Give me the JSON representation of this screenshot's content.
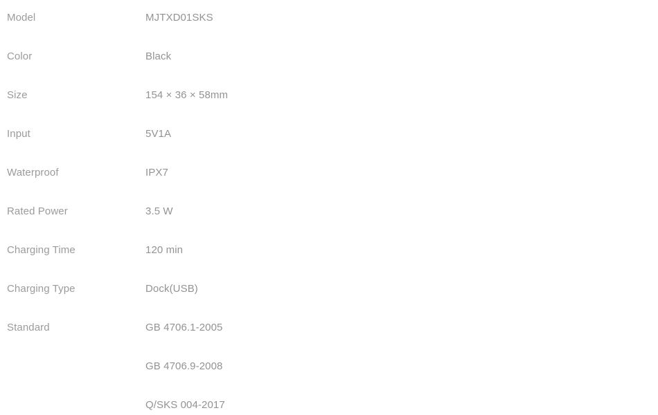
{
  "spec_table": {
    "rows": [
      {
        "label": "Model",
        "value": "MJTXD01SKS"
      },
      {
        "label": "Color",
        "value": "Black"
      },
      {
        "label": "Size",
        "value": "154 × 36 × 58mm"
      },
      {
        "label": "Input",
        "value": "5V1A"
      },
      {
        "label": "Waterproof",
        "value": "IPX7"
      },
      {
        "label": "Rated Power",
        "value": "3.5 W"
      },
      {
        "label": "Charging Time",
        "value": "120 min"
      },
      {
        "label": "Charging Type",
        "value": "Dock(USB)"
      }
    ],
    "standard": {
      "label": "Standard",
      "lines": [
        "GB 4706.1-2005",
        "GB 4706.9-2008",
        "Q/SKS 004-2017"
      ]
    }
  },
  "colors": {
    "background": "#ffffff",
    "label_text": "#9b9b9e",
    "value_text": "#939397"
  }
}
